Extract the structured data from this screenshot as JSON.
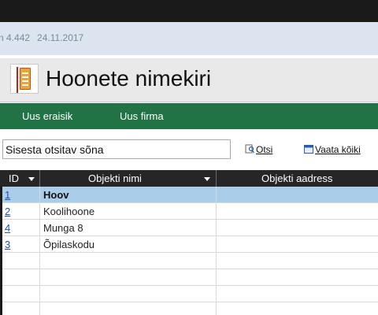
{
  "header": {
    "version": "n 4.442",
    "date": "24.11.2017",
    "title": "Hoonete nimekiri"
  },
  "nav": {
    "new_private": "Uus eraisik",
    "new_company": "Uus firma"
  },
  "search": {
    "value": "Sisesta otsitav sõna",
    "search_label": "Otsi",
    "view_all_label": "Vaata kõiki"
  },
  "table": {
    "columns": [
      "ID",
      "Objekti nimi",
      "Objekti aadress"
    ],
    "rows": [
      {
        "id": "1",
        "name": "Hoov",
        "address": ""
      },
      {
        "id": "2",
        "name": "Koolihoone",
        "address": ""
      },
      {
        "id": "4",
        "name": "Munga 8",
        "address": ""
      },
      {
        "id": "3",
        "name": "Õpilaskodu",
        "address": ""
      }
    ]
  },
  "colors": {
    "green_bar": "#217346",
    "selected_row": "#aacde9",
    "header_bg": "#262626"
  },
  "icons": [
    "document-icon",
    "search-icon",
    "view-all-icon",
    "sort-arrow-icon"
  ]
}
